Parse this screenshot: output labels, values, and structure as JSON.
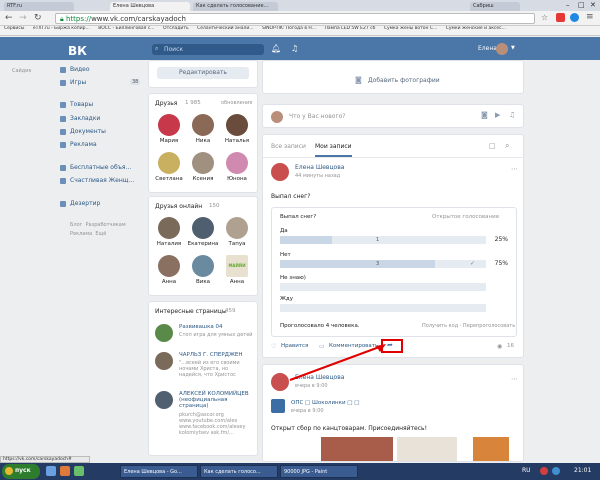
{
  "browser": {
    "tabs": [
      "RTF.ru",
      "Елена Шевцова",
      "Как сделать голосование...",
      "Сабриш"
    ],
    "url_scheme": "https://",
    "url_host": "www.vk.com",
    "url_path": "/carskayadoch",
    "bookmarks": [
      "Сервисы",
      "eTXT.ru - Биржа копир...",
      "BOCC - Биллинговая с...",
      "Отсладить",
      "Селантический анали...",
      "SINOPTIK: Погода в Н...",
      "Лампа LED 5W E27 сб",
      "Сумка жены вотон С...",
      "Сумки женские и аксес..."
    ],
    "status_url": "https://vk.com/carskayadoch#"
  },
  "vk": {
    "logo": "ВК",
    "search_placeholder": "Поиск",
    "user_name": "Елена"
  },
  "nav": {
    "top": "Сайдик",
    "items": [
      "Видео",
      "Игры",
      "Товары",
      "Закладки",
      "Документы",
      "Реклама",
      "Бесплатные объя...",
      "Счастливая Женщ...",
      "Дезертир"
    ],
    "games_badge": "38",
    "footer": [
      "Блог",
      "Разработчикам",
      "Реклама",
      "Ещё"
    ]
  },
  "profile": {
    "edit_button": "Редактировать",
    "friends_title": "Друзья",
    "friends_count": "1 985",
    "friends_update": "обновления",
    "friends": [
      "Мария",
      "Ника",
      "Наталья",
      "Светлана",
      "Ксения",
      "Юнона"
    ],
    "online_title": "Друзья онлайн",
    "online_count": "150",
    "online": [
      "Наталия",
      "Екатерина",
      "Тапуа",
      "Анна",
      "Вика",
      "Анна"
    ],
    "online_third_caption": "МАЙЙИ",
    "pages_title": "Интересные страницы",
    "pages_count": "459",
    "pages": [
      {
        "name": "Развивашка 04",
        "desc": "Стоп игра для умных детей"
      },
      {
        "name": "ЧАРЛЬЗ Г. СПЕРДЖЕН",
        "desc": "\"...всеей из его своими ночами Христа, но надейся, что Христос"
      },
      {
        "name": "АЛЕКСЕЙ КОЛОМИЙЦЕВ (неофициальная страница)",
        "desc": "pkurch@ascor.org\nwww.youtube.com/alex\nwww.facebook.com/alexey\nkolomiytsev ask.fm/..."
      }
    ]
  },
  "main": {
    "add_photo": "Добавить фотографии",
    "composer_placeholder": "Что у Вас нового?",
    "tabs": [
      "Все записи",
      "Мои записи"
    ],
    "post1": {
      "author": "Елена Шевцова",
      "time": "44 минуты назад",
      "text": "Выпал снег?",
      "poll_question": "Выпал снег?",
      "poll_type": "Открытое голосование",
      "options": [
        {
          "label": "Да",
          "count": "1",
          "percent": "25%",
          "fill": 0.25
        },
        {
          "label": "Нет",
          "count": "3",
          "percent": "75%",
          "fill": 0.75
        },
        {
          "label": "Не знаю)",
          "count": "",
          "percent": "",
          "fill": 0
        },
        {
          "label": "Жду",
          "count": "",
          "percent": "",
          "fill": 0
        }
      ],
      "voted": "Проголосовало 4 человека.",
      "poll_link": "Получить код · Перепроголосовать",
      "like": "Нравится",
      "comment": "Комментировать",
      "views": "16"
    },
    "post2": {
      "author": "Елена Шевцова",
      "time": "вчера в 9:00",
      "repost_author": "ОПС □ Шоколинки □ □",
      "repost_time": "вчера в 9:00",
      "text": "Открыт сбор по канцтоварам. Присоединяйтесь!"
    }
  },
  "taskbar": {
    "start": "пуск",
    "tasks": [
      "Елена Шевцова - Go...",
      "Как сделать голосо...",
      "90000 JPG - Paint"
    ],
    "tray": "RU",
    "clock": "21:01"
  },
  "colors": {
    "vk_blue": "#4a76a8",
    "link": "#2a5885",
    "annotation_red": "#e00000"
  }
}
